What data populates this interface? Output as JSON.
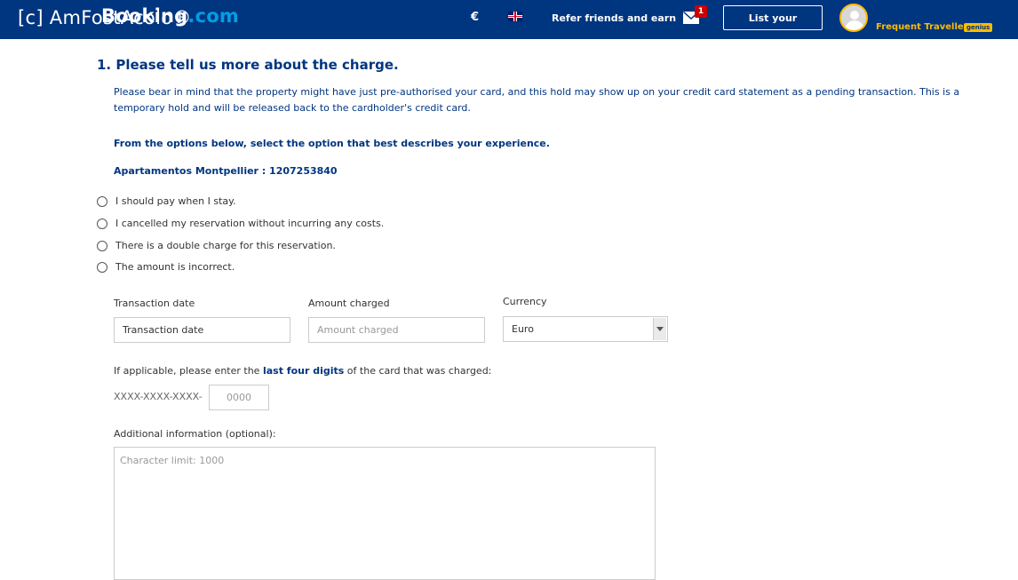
{
  "header": {
    "logo_prefix": "Booking",
    "logo_suffix": ".com",
    "watermark": "[c] AmFostAcolo®",
    "currency": "€",
    "language_icon": "uk-flag-icon",
    "refer_label": "Refer friends and earn",
    "messages_badge": "1",
    "list_property_label": "List your property",
    "user_name": "Frequent Traveller",
    "user_badge": "genius",
    "colors": {
      "bar": "#003580",
      "accent": "#febb02",
      "logo_dot": "#009fe3"
    }
  },
  "form": {
    "heading": "1. Please tell us more about the charge.",
    "intro": "Please bear in mind that the property might have just pre-authorised your card, and this hold may show up on your credit card statement as a pending transaction. This is a temporary hold and will be released back to the cardholder's credit card.",
    "instruction": "From the options below, select the option that best describes your experience.",
    "property": "Apartamentos Montpellier : 1207253840",
    "options": [
      {
        "label": "I should pay when I stay."
      },
      {
        "label": "I cancelled my reservation without incurring any costs."
      },
      {
        "label": "There is a double charge for this reservation."
      },
      {
        "label": "The amount is incorrect."
      }
    ],
    "transaction_date": {
      "label": "Transaction date",
      "value": "Transaction date"
    },
    "amount_charged": {
      "label": "Amount charged",
      "placeholder": "Amount charged"
    },
    "currency": {
      "label": "Currency",
      "value": "Euro"
    },
    "card": {
      "text_before": "If applicable, please enter the ",
      "text_bold": "last four digits",
      "text_after": " of the card that was charged:",
      "prefix": "XXXX-XXXX-XXXX-",
      "placeholder": "0000"
    },
    "additional": {
      "label": "Additional information (optional):",
      "placeholder": "Character limit: 1000"
    }
  }
}
